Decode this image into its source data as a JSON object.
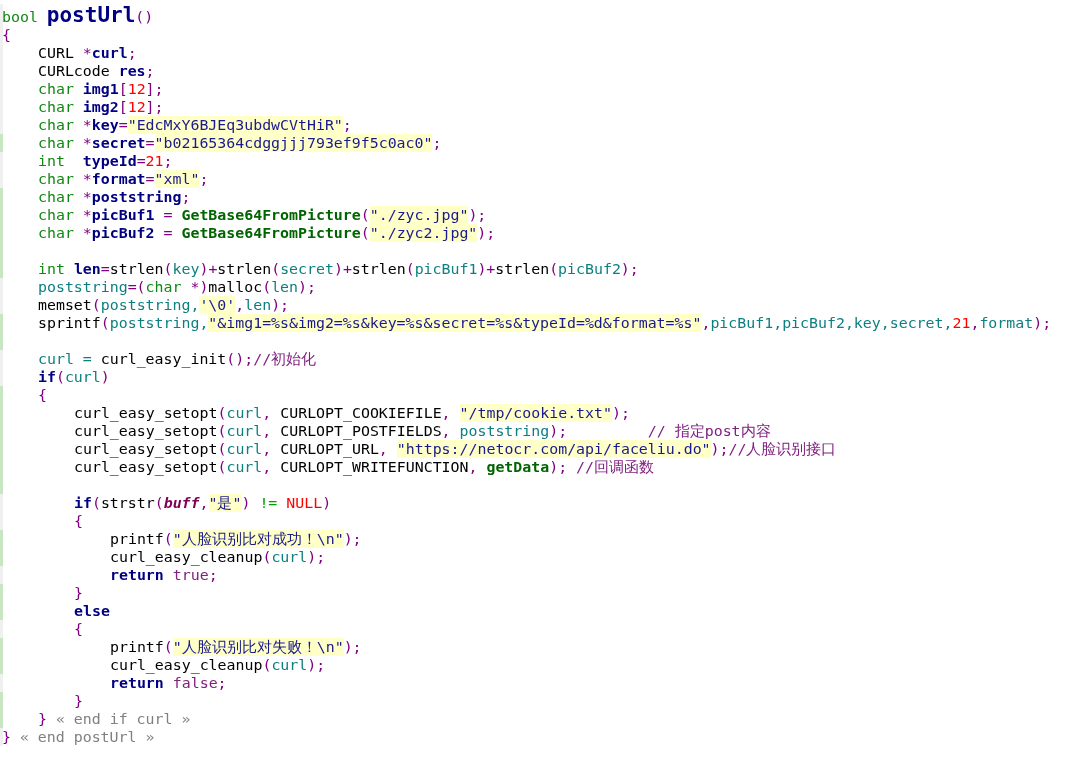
{
  "lines": [
    {
      "kind": "code",
      "changed": false,
      "tokens": [
        {
          "kind": "type",
          "text": "bool "
        },
        {
          "kind": "title",
          "text": "postUrl"
        },
        {
          "kind": "punct",
          "text": "()"
        }
      ]
    },
    {
      "kind": "code",
      "changed": false,
      "tokens": [
        {
          "kind": "punct",
          "text": "{"
        }
      ],
      "children": [
        {
          "kind": "code",
          "changed": false,
          "tokens": [
            {
              "kind": "plain",
              "text": "CURL "
            },
            {
              "kind": "punct",
              "text": "*"
            },
            {
              "kind": "decl",
              "text": "curl"
            },
            {
              "kind": "punct",
              "text": ";"
            }
          ]
        },
        {
          "kind": "code",
          "changed": false,
          "tokens": [
            {
              "kind": "plain",
              "text": "CURLcode "
            },
            {
              "kind": "decl",
              "text": "res"
            },
            {
              "kind": "punct",
              "text": ";"
            }
          ]
        },
        {
          "kind": "code",
          "changed": false,
          "tokens": [
            {
              "kind": "type",
              "text": "char "
            },
            {
              "kind": "decl",
              "text": "img1"
            },
            {
              "kind": "punct",
              "text": "["
            },
            {
              "kind": "number",
              "text": "12"
            },
            {
              "kind": "punct",
              "text": "];"
            }
          ]
        },
        {
          "kind": "code",
          "changed": false,
          "tokens": [
            {
              "kind": "type",
              "text": "char "
            },
            {
              "kind": "decl",
              "text": "img2"
            },
            {
              "kind": "punct",
              "text": "["
            },
            {
              "kind": "number",
              "text": "12"
            },
            {
              "kind": "punct",
              "text": "];"
            }
          ]
        },
        {
          "kind": "code",
          "changed": false,
          "tokens": [
            {
              "kind": "type",
              "text": "char "
            },
            {
              "kind": "punct",
              "text": "*"
            },
            {
              "kind": "decl",
              "text": "key"
            },
            {
              "kind": "punct",
              "text": "="
            },
            {
              "kind": "string",
              "text": "\"EdcMxY6BJEq3ubdwCVtHiR\""
            },
            {
              "kind": "punct",
              "text": ";"
            }
          ]
        },
        {
          "kind": "code",
          "changed": true,
          "tokens": [
            {
              "kind": "type",
              "text": "char "
            },
            {
              "kind": "punct",
              "text": "*"
            },
            {
              "kind": "decl",
              "text": "secret"
            },
            {
              "kind": "punct",
              "text": "="
            },
            {
              "kind": "string",
              "text": "\"b02165364cdggjjj793ef9f5c0ac0\""
            },
            {
              "kind": "punct",
              "text": ";"
            }
          ]
        },
        {
          "kind": "code",
          "changed": false,
          "tokens": [
            {
              "kind": "type",
              "text": "int  "
            },
            {
              "kind": "decl",
              "text": "typeId"
            },
            {
              "kind": "punct",
              "text": "="
            },
            {
              "kind": "number",
              "text": "21"
            },
            {
              "kind": "punct",
              "text": ";"
            }
          ]
        },
        {
          "kind": "code",
          "changed": false,
          "tokens": [
            {
              "kind": "type",
              "text": "char "
            },
            {
              "kind": "punct",
              "text": "*"
            },
            {
              "kind": "decl",
              "text": "format"
            },
            {
              "kind": "punct",
              "text": "="
            },
            {
              "kind": "string",
              "text": "\"xml\""
            },
            {
              "kind": "punct",
              "text": ";"
            }
          ]
        },
        {
          "kind": "code",
          "changed": true,
          "tokens": [
            {
              "kind": "type",
              "text": "char "
            },
            {
              "kind": "punct",
              "text": "*"
            },
            {
              "kind": "decl",
              "text": "poststring"
            },
            {
              "kind": "punct",
              "text": ";"
            }
          ]
        },
        {
          "kind": "code",
          "changed": true,
          "tokens": [
            {
              "kind": "type",
              "text": "char "
            },
            {
              "kind": "punct",
              "text": "*"
            },
            {
              "kind": "decl",
              "text": "picBuf1"
            },
            {
              "kind": "punct",
              "text": " = "
            },
            {
              "kind": "func",
              "text": "GetBase64FromPicture"
            },
            {
              "kind": "punct",
              "text": "("
            },
            {
              "kind": "string",
              "text": "\"./zyc.jpg\""
            },
            {
              "kind": "punct",
              "text": ");"
            }
          ]
        },
        {
          "kind": "code",
          "changed": true,
          "tokens": [
            {
              "kind": "type",
              "text": "char "
            },
            {
              "kind": "punct",
              "text": "*"
            },
            {
              "kind": "decl",
              "text": "picBuf2"
            },
            {
              "kind": "punct",
              "text": " = "
            },
            {
              "kind": "func",
              "text": "GetBase64FromPicture"
            },
            {
              "kind": "punct",
              "text": "("
            },
            {
              "kind": "string",
              "text": "\"./zyc2.jpg\""
            },
            {
              "kind": "punct",
              "text": ");"
            }
          ]
        },
        {
          "kind": "blank",
          "changed": true
        },
        {
          "kind": "code",
          "changed": true,
          "tokens": [
            {
              "kind": "type",
              "text": "int "
            },
            {
              "kind": "decl",
              "text": "len"
            },
            {
              "kind": "punct",
              "text": "="
            },
            {
              "kind": "plain",
              "text": "strlen"
            },
            {
              "kind": "punct",
              "text": "("
            },
            {
              "kind": "var",
              "text": "key"
            },
            {
              "kind": "punct",
              "text": ")+"
            },
            {
              "kind": "plain",
              "text": "strlen"
            },
            {
              "kind": "punct",
              "text": "("
            },
            {
              "kind": "var",
              "text": "secret"
            },
            {
              "kind": "punct",
              "text": ")+"
            },
            {
              "kind": "plain",
              "text": "strlen"
            },
            {
              "kind": "punct",
              "text": "("
            },
            {
              "kind": "var",
              "text": "picBuf1"
            },
            {
              "kind": "punct",
              "text": ")+"
            },
            {
              "kind": "plain",
              "text": "strlen"
            },
            {
              "kind": "punct",
              "text": "("
            },
            {
              "kind": "var",
              "text": "picBuf2"
            },
            {
              "kind": "punct",
              "text": ");"
            }
          ]
        },
        {
          "kind": "code",
          "changed": false,
          "tokens": [
            {
              "kind": "var",
              "text": "poststring"
            },
            {
              "kind": "punct",
              "text": "=("
            },
            {
              "kind": "type",
              "text": "char "
            },
            {
              "kind": "punct",
              "text": "*)"
            },
            {
              "kind": "plain",
              "text": "malloc"
            },
            {
              "kind": "punct",
              "text": "("
            },
            {
              "kind": "var",
              "text": "len"
            },
            {
              "kind": "punct",
              "text": ");"
            }
          ]
        },
        {
          "kind": "code",
          "changed": false,
          "tokens": [
            {
              "kind": "plain",
              "text": "memset"
            },
            {
              "kind": "punct",
              "text": "("
            },
            {
              "kind": "var",
              "text": "poststring,"
            },
            {
              "kind": "string",
              "text": "'\\0'"
            },
            {
              "kind": "punct",
              "text": ","
            },
            {
              "kind": "var",
              "text": "len"
            },
            {
              "kind": "punct",
              "text": ");"
            }
          ]
        },
        {
          "kind": "code",
          "changed": true,
          "tokens": [
            {
              "kind": "plain",
              "text": "sprintf"
            },
            {
              "kind": "punct",
              "text": "("
            },
            {
              "kind": "var",
              "text": "poststring,"
            },
            {
              "kind": "string",
              "text": "\"&img1=%s&img2=%s&key=%s&secret=%s&typeId=%d&format=%s\""
            },
            {
              "kind": "punct",
              "text": ","
            },
            {
              "kind": "var",
              "text": "picBuf1,picBuf2,key,secret,"
            },
            {
              "kind": "number",
              "text": "21"
            },
            {
              "kind": "punct",
              "text": ","
            },
            {
              "kind": "var",
              "text": "format"
            },
            {
              "kind": "punct",
              "text": ");"
            }
          ]
        },
        {
          "kind": "blank",
          "changed": true
        },
        {
          "kind": "code",
          "changed": false,
          "tokens": [
            {
              "kind": "var",
              "text": "curl = "
            },
            {
              "kind": "plain",
              "text": "curl_easy_init"
            },
            {
              "kind": "punct",
              "text": "();"
            },
            {
              "kind": "comment",
              "text": "//初始化"
            }
          ]
        },
        {
          "kind": "code",
          "changed": false,
          "tokens": [
            {
              "kind": "keyword",
              "text": "if"
            },
            {
              "kind": "punct",
              "text": "("
            },
            {
              "kind": "var",
              "text": "curl"
            },
            {
              "kind": "punct",
              "text": ")"
            }
          ]
        },
        {
          "kind": "code",
          "changed": true,
          "tokens": [
            {
              "kind": "punct",
              "text": "{"
            }
          ],
          "children": [
            {
              "kind": "code",
              "changed": true,
              "tokens": [
                {
                  "kind": "plain",
                  "text": "curl_easy_setopt"
                },
                {
                  "kind": "punct",
                  "text": "("
                },
                {
                  "kind": "var",
                  "text": "curl"
                },
                {
                  "kind": "punct",
                  "text": ", "
                },
                {
                  "kind": "plain",
                  "text": "CURLOPT_COOKIEFILE"
                },
                {
                  "kind": "punct",
                  "text": ", "
                },
                {
                  "kind": "string",
                  "text": "\"/tmp/cookie.txt\""
                },
                {
                  "kind": "punct",
                  "text": ");"
                }
              ]
            },
            {
              "kind": "code",
              "changed": true,
              "tokens": [
                {
                  "kind": "plain",
                  "text": "curl_easy_setopt"
                },
                {
                  "kind": "punct",
                  "text": "("
                },
                {
                  "kind": "var",
                  "text": "curl"
                },
                {
                  "kind": "punct",
                  "text": ", "
                },
                {
                  "kind": "plain",
                  "text": "CURLOPT_POSTFIELDS"
                },
                {
                  "kind": "punct",
                  "text": ", "
                },
                {
                  "kind": "var",
                  "text": "poststring"
                },
                {
                  "kind": "punct",
                  "text": ");         "
                },
                {
                  "kind": "comment",
                  "text": "// 指定post内容"
                }
              ]
            },
            {
              "kind": "code",
              "changed": true,
              "tokens": [
                {
                  "kind": "plain",
                  "text": "curl_easy_setopt"
                },
                {
                  "kind": "punct",
                  "text": "("
                },
                {
                  "kind": "var",
                  "text": "curl"
                },
                {
                  "kind": "punct",
                  "text": ", "
                },
                {
                  "kind": "plain",
                  "text": "CURLOPT_URL"
                },
                {
                  "kind": "punct",
                  "text": ", "
                },
                {
                  "kind": "string",
                  "text": "\"https://netocr.com/api/faceliu.do\""
                },
                {
                  "kind": "punct",
                  "text": ");"
                },
                {
                  "kind": "comment",
                  "text": "//人脸识别接口"
                }
              ]
            },
            {
              "kind": "code",
              "changed": true,
              "tokens": [
                {
                  "kind": "plain",
                  "text": "curl_easy_setopt"
                },
                {
                  "kind": "punct",
                  "text": "("
                },
                {
                  "kind": "var",
                  "text": "curl"
                },
                {
                  "kind": "punct",
                  "text": ", "
                },
                {
                  "kind": "plain",
                  "text": "CURLOPT_WRITEFUNCTION"
                },
                {
                  "kind": "punct",
                  "text": ", "
                },
                {
                  "kind": "func",
                  "text": "getData"
                },
                {
                  "kind": "punct",
                  "text": "); "
                },
                {
                  "kind": "comment",
                  "text": "//回调函数"
                }
              ]
            },
            {
              "kind": "blank",
              "changed": true
            },
            {
              "kind": "code",
              "changed": false,
              "tokens": [
                {
                  "kind": "keyword",
                  "text": "if"
                },
                {
                  "kind": "punct",
                  "text": "("
                },
                {
                  "kind": "plain",
                  "text": "strstr"
                },
                {
                  "kind": "punct",
                  "text": "("
                },
                {
                  "kind": "param",
                  "text": "buff"
                },
                {
                  "kind": "punct",
                  "text": ","
                },
                {
                  "kind": "string",
                  "text": "\"是\""
                },
                {
                  "kind": "punct",
                  "text": ") "
                },
                {
                  "kind": "operator",
                  "text": "!= "
                },
                {
                  "kind": "constant",
                  "text": "NULL"
                },
                {
                  "kind": "punct",
                  "text": ")"
                }
              ]
            },
            {
              "kind": "code",
              "changed": false,
              "tokens": [
                {
                  "kind": "punct",
                  "text": "{"
                }
              ],
              "children": [
                {
                  "kind": "code",
                  "changed": true,
                  "tokens": [
                    {
                      "kind": "plain",
                      "text": "printf"
                    },
                    {
                      "kind": "punct",
                      "text": "("
                    },
                    {
                      "kind": "string",
                      "text": "\"人脸识别比对成功！\\n\""
                    },
                    {
                      "kind": "punct",
                      "text": ");"
                    }
                  ]
                },
                {
                  "kind": "code",
                  "changed": true,
                  "tokens": [
                    {
                      "kind": "plain",
                      "text": "curl_easy_cleanup"
                    },
                    {
                      "kind": "punct",
                      "text": "("
                    },
                    {
                      "kind": "var",
                      "text": "curl"
                    },
                    {
                      "kind": "punct",
                      "text": ");"
                    }
                  ]
                },
                {
                  "kind": "code",
                  "changed": false,
                  "tokens": [
                    {
                      "kind": "keyword",
                      "text": "return "
                    },
                    {
                      "kind": "literal",
                      "text": "true"
                    },
                    {
                      "kind": "punct",
                      "text": ";"
                    }
                  ]
                }
              ]
            },
            {
              "kind": "code",
              "changed": true,
              "tokens": [
                {
                  "kind": "punct",
                  "text": "}"
                }
              ]
            },
            {
              "kind": "code",
              "changed": true,
              "tokens": [
                {
                  "kind": "keyword",
                  "text": "else"
                }
              ]
            },
            {
              "kind": "code",
              "changed": false,
              "tokens": [
                {
                  "kind": "punct",
                  "text": "{"
                }
              ],
              "children": [
                {
                  "kind": "code",
                  "changed": true,
                  "tokens": [
                    {
                      "kind": "plain",
                      "text": "printf"
                    },
                    {
                      "kind": "punct",
                      "text": "("
                    },
                    {
                      "kind": "string",
                      "text": "\"人脸识别比对失败！\\n\""
                    },
                    {
                      "kind": "punct",
                      "text": ");"
                    }
                  ]
                },
                {
                  "kind": "code",
                  "changed": true,
                  "tokens": [
                    {
                      "kind": "plain",
                      "text": "curl_easy_cleanup"
                    },
                    {
                      "kind": "punct",
                      "text": "("
                    },
                    {
                      "kind": "var",
                      "text": "curl"
                    },
                    {
                      "kind": "punct",
                      "text": ");"
                    }
                  ]
                },
                {
                  "kind": "code",
                  "changed": false,
                  "tokens": [
                    {
                      "kind": "keyword",
                      "text": "return "
                    },
                    {
                      "kind": "literal",
                      "text": "false"
                    },
                    {
                      "kind": "punct",
                      "text": ";"
                    }
                  ]
                }
              ]
            },
            {
              "kind": "code",
              "changed": true,
              "tokens": [
                {
                  "kind": "punct",
                  "text": "}"
                }
              ]
            }
          ]
        },
        {
          "kind": "code",
          "changed": true,
          "tokens": [
            {
              "kind": "punct",
              "text": "} "
            },
            {
              "kind": "annotation",
              "text": "« end if curl »"
            }
          ]
        }
      ]
    },
    {
      "kind": "code",
      "changed": false,
      "tokens": [
        {
          "kind": "punct",
          "text": "} "
        },
        {
          "kind": "annotation",
          "text": "« end postUrl »"
        }
      ]
    }
  ]
}
